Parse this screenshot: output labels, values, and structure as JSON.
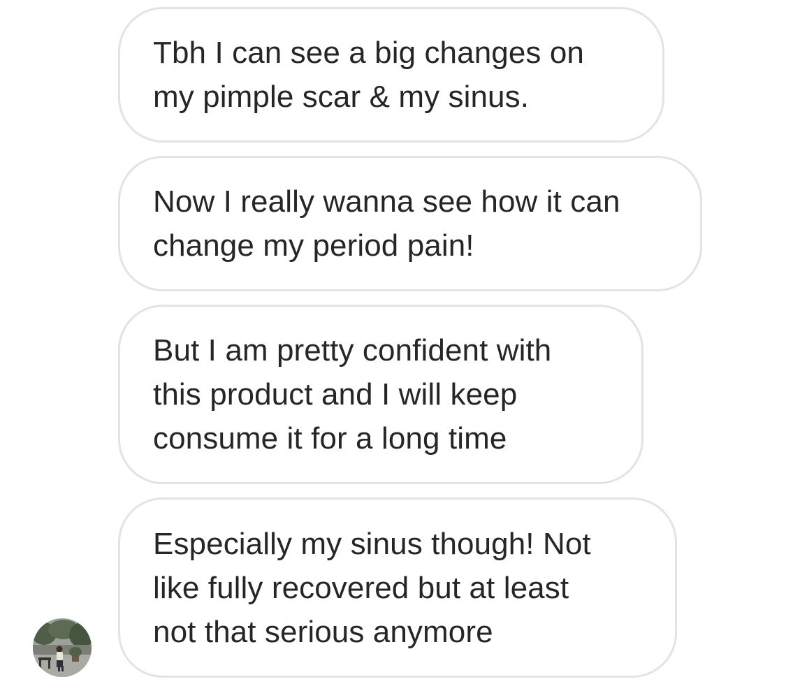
{
  "conversation": {
    "messages": [
      {
        "text": "Tbh I can see a big changes on\nmy pimple scar & my sinus."
      },
      {
        "text": "Now I really wanna see how it can\nchange my period pain!"
      },
      {
        "text": "But I am pretty confident with\nthis product and I will keep\nconsume it for a long time"
      },
      {
        "text": "Especially my sinus though! Not\nlike fully recovered but at least\nnot that serious anymore"
      }
    ]
  },
  "sender": {
    "avatar_icon": "profile-photo-avatar"
  },
  "colors": {
    "bubble_border": "#e3e3e3",
    "text": "#262626",
    "background": "#ffffff"
  }
}
